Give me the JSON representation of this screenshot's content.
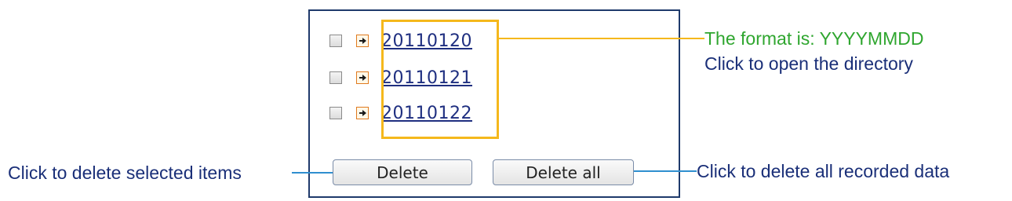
{
  "directories": [
    {
      "name": "20110120",
      "checked": false
    },
    {
      "name": "20110121",
      "checked": false
    },
    {
      "name": "20110122",
      "checked": false
    }
  ],
  "icons": {
    "checkbox": "checkbox-unchecked",
    "open": "arrow-right-icon"
  },
  "buttons": {
    "delete_label": "Delete",
    "delete_all_label": "Delete all"
  },
  "annotations": {
    "format": "The format is: YYYYMMDD",
    "open_directory": "Click to open the directory",
    "delete_selected": "Click to delete selected items",
    "delete_all": "Click to delete all recorded data"
  },
  "colors": {
    "panel_border": "#1f3a6b",
    "highlight": "#f5b81c",
    "format_text": "#2fa62f",
    "annotation_text": "#1a2f78",
    "link": "#1f2f80",
    "callout_line": "#2f8fcf"
  }
}
